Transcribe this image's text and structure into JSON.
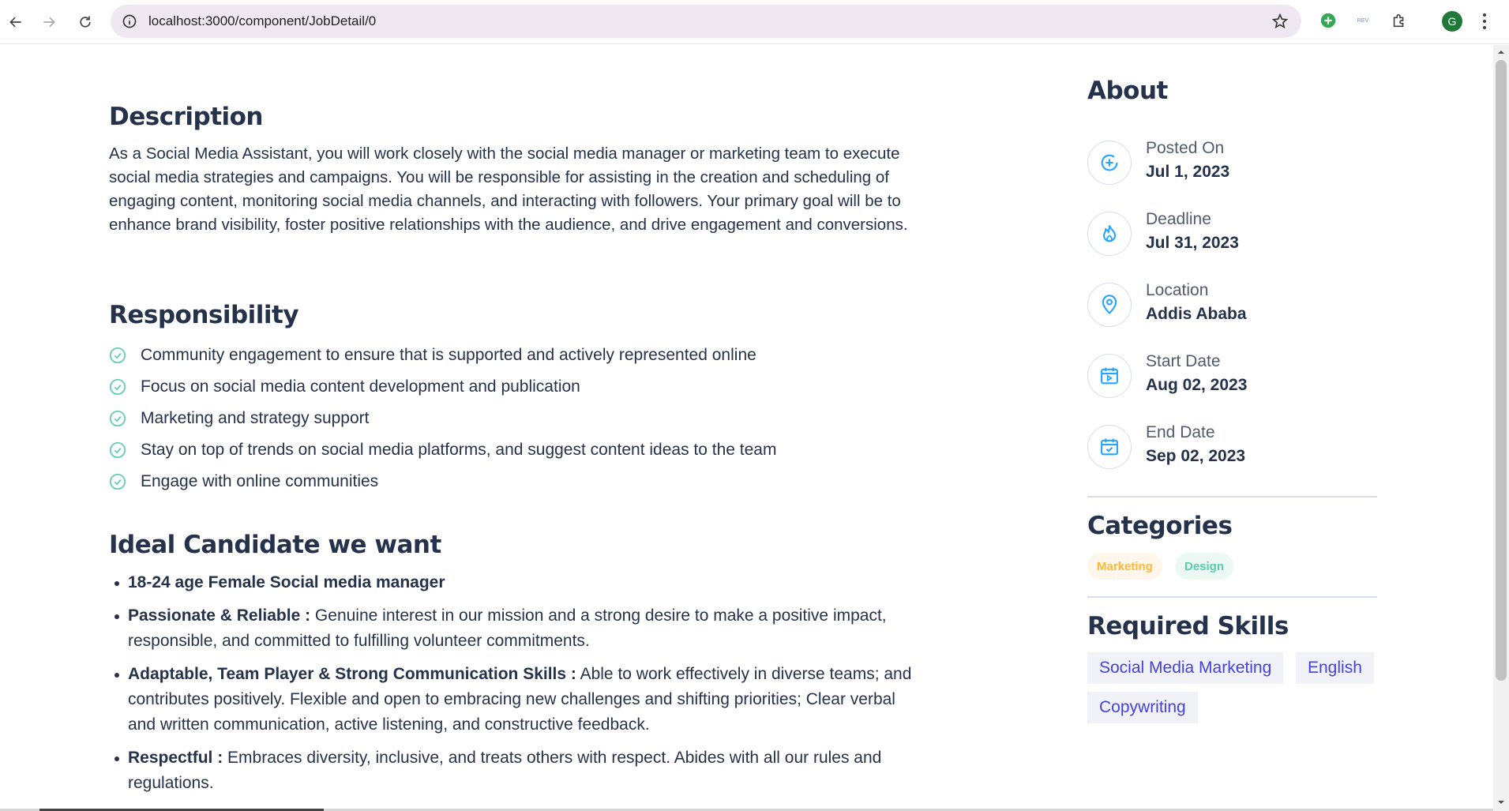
{
  "browser": {
    "url": "localhost:3000/component/JobDetail/0",
    "ext_label": "REV",
    "avatar_letter": "G"
  },
  "description": {
    "title": "Description",
    "text": "As a Social Media Assistant, you will work closely with the social media manager or marketing team to execute social media strategies and campaigns. You will be responsible for assisting in the creation and scheduling of engaging content, monitoring social media channels, and interacting with followers. Your primary goal will be to enhance brand visibility, foster positive relationships with the audience, and drive engagement and conversions."
  },
  "responsibility": {
    "title": "Responsibility",
    "items": [
      "Community engagement to ensure that is supported and actively represented online",
      "Focus on social media content development and publication",
      "Marketing and strategy support",
      "Stay on top of trends on social media platforms, and suggest content ideas to the team",
      "Engage with online communities"
    ]
  },
  "ideal": {
    "title": "Ideal Candidate we want",
    "items": [
      {
        "bold": "18-24 age Female Social media manager",
        "text": ""
      },
      {
        "bold": "Passionate & Reliable :",
        "text": " Genuine interest in our mission and a strong desire to make a positive impact, responsible, and committed to fulfilling volunteer commitments."
      },
      {
        "bold": "Adaptable, Team Player & Strong Communication Skills :",
        "text": " Able to work effectively in diverse teams; and contributes positively. Flexible and open to embracing new challenges and shifting priorities; Clear verbal and written communication, active listening, and constructive feedback."
      },
      {
        "bold": "Respectful :",
        "text": " Embraces diversity, inclusive, and treats others with respect. Abides with all our rules and regulations."
      }
    ]
  },
  "about": {
    "title": "About",
    "posted_label": "Posted On",
    "posted_value": "Jul 1, 2023",
    "deadline_label": "Deadline",
    "deadline_value": "Jul 31, 2023",
    "location_label": "Location",
    "location_value": "Addis Ababa",
    "start_label": "Start Date",
    "start_value": "Aug 02, 2023",
    "end_label": "End Date",
    "end_value": "Sep 02, 2023"
  },
  "categories": {
    "title": "Categories",
    "items": [
      "Marketing",
      "Design"
    ]
  },
  "skills": {
    "title": "Required Skills",
    "items": [
      "Social Media Marketing",
      "English",
      "Copywriting"
    ]
  },
  "colors": {
    "heading": "#25324B",
    "accent": "#26A4FF",
    "check": "#56CDAD",
    "skill": "#4640DE"
  }
}
